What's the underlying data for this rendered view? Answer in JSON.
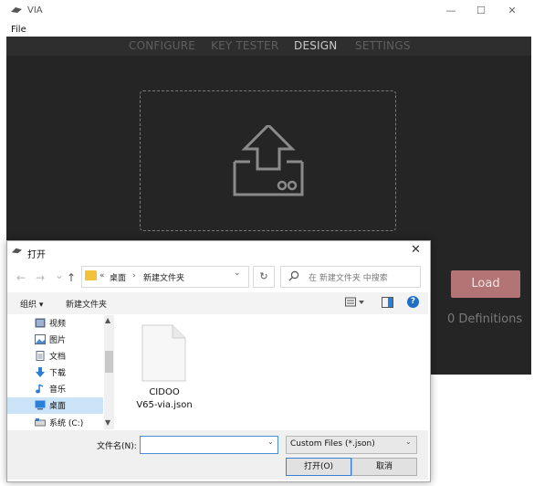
{
  "via_window": {
    "title": "VIA",
    "menu": [
      "File"
    ],
    "window_controls": [
      "—",
      "☐",
      "✕"
    ],
    "tabs": [
      {
        "label": "CONFIGURE",
        "active": false
      },
      {
        "label": "KEY TESTER",
        "active": false
      },
      {
        "label": "DESIGN",
        "active": true
      },
      {
        "label": "SETTINGS",
        "active": false
      }
    ],
    "upload_icon": "upload-icon",
    "load_button": "Load",
    "definitions": "0 Definitions",
    "colors": {
      "background": "#252525",
      "load_button": "#b27474"
    }
  },
  "dialog": {
    "title": "打开",
    "close": "✕",
    "nav": {
      "back": "←",
      "forward": "→",
      "recent": "⌄",
      "up": "↑"
    },
    "address": {
      "prefix": "«",
      "crumb1": "桌面",
      "sep": "›",
      "crumb2": "新建文件夹",
      "chevron": "⌄"
    },
    "refresh": "↻",
    "search_placeholder": "在 新建文件夹 中搜索",
    "toolbar": {
      "organize": "组织 ▾",
      "new_folder": "新建文件夹",
      "help": "?"
    },
    "sidebar": [
      {
        "label": "视频",
        "icon": "video-icon",
        "selected": false
      },
      {
        "label": "图片",
        "icon": "picture-icon",
        "selected": false
      },
      {
        "label": "文档",
        "icon": "document-icon",
        "selected": false
      },
      {
        "label": "下载",
        "icon": "download-icon",
        "selected": false
      },
      {
        "label": "音乐",
        "icon": "music-icon",
        "selected": false
      },
      {
        "label": "桌面",
        "icon": "desktop-icon",
        "selected": true
      },
      {
        "label": "系统 (C:)",
        "icon": "drive-icon",
        "selected": false
      }
    ],
    "files": [
      {
        "name_line1": "CIDOO",
        "name_line2": "V65-via.json",
        "icon": "file-icon"
      }
    ],
    "filename_label": "文件名(N):",
    "filename_value": "",
    "file_type": "Custom Files (*.json)",
    "open_button": "打开(O)",
    "cancel_button": "取消"
  }
}
